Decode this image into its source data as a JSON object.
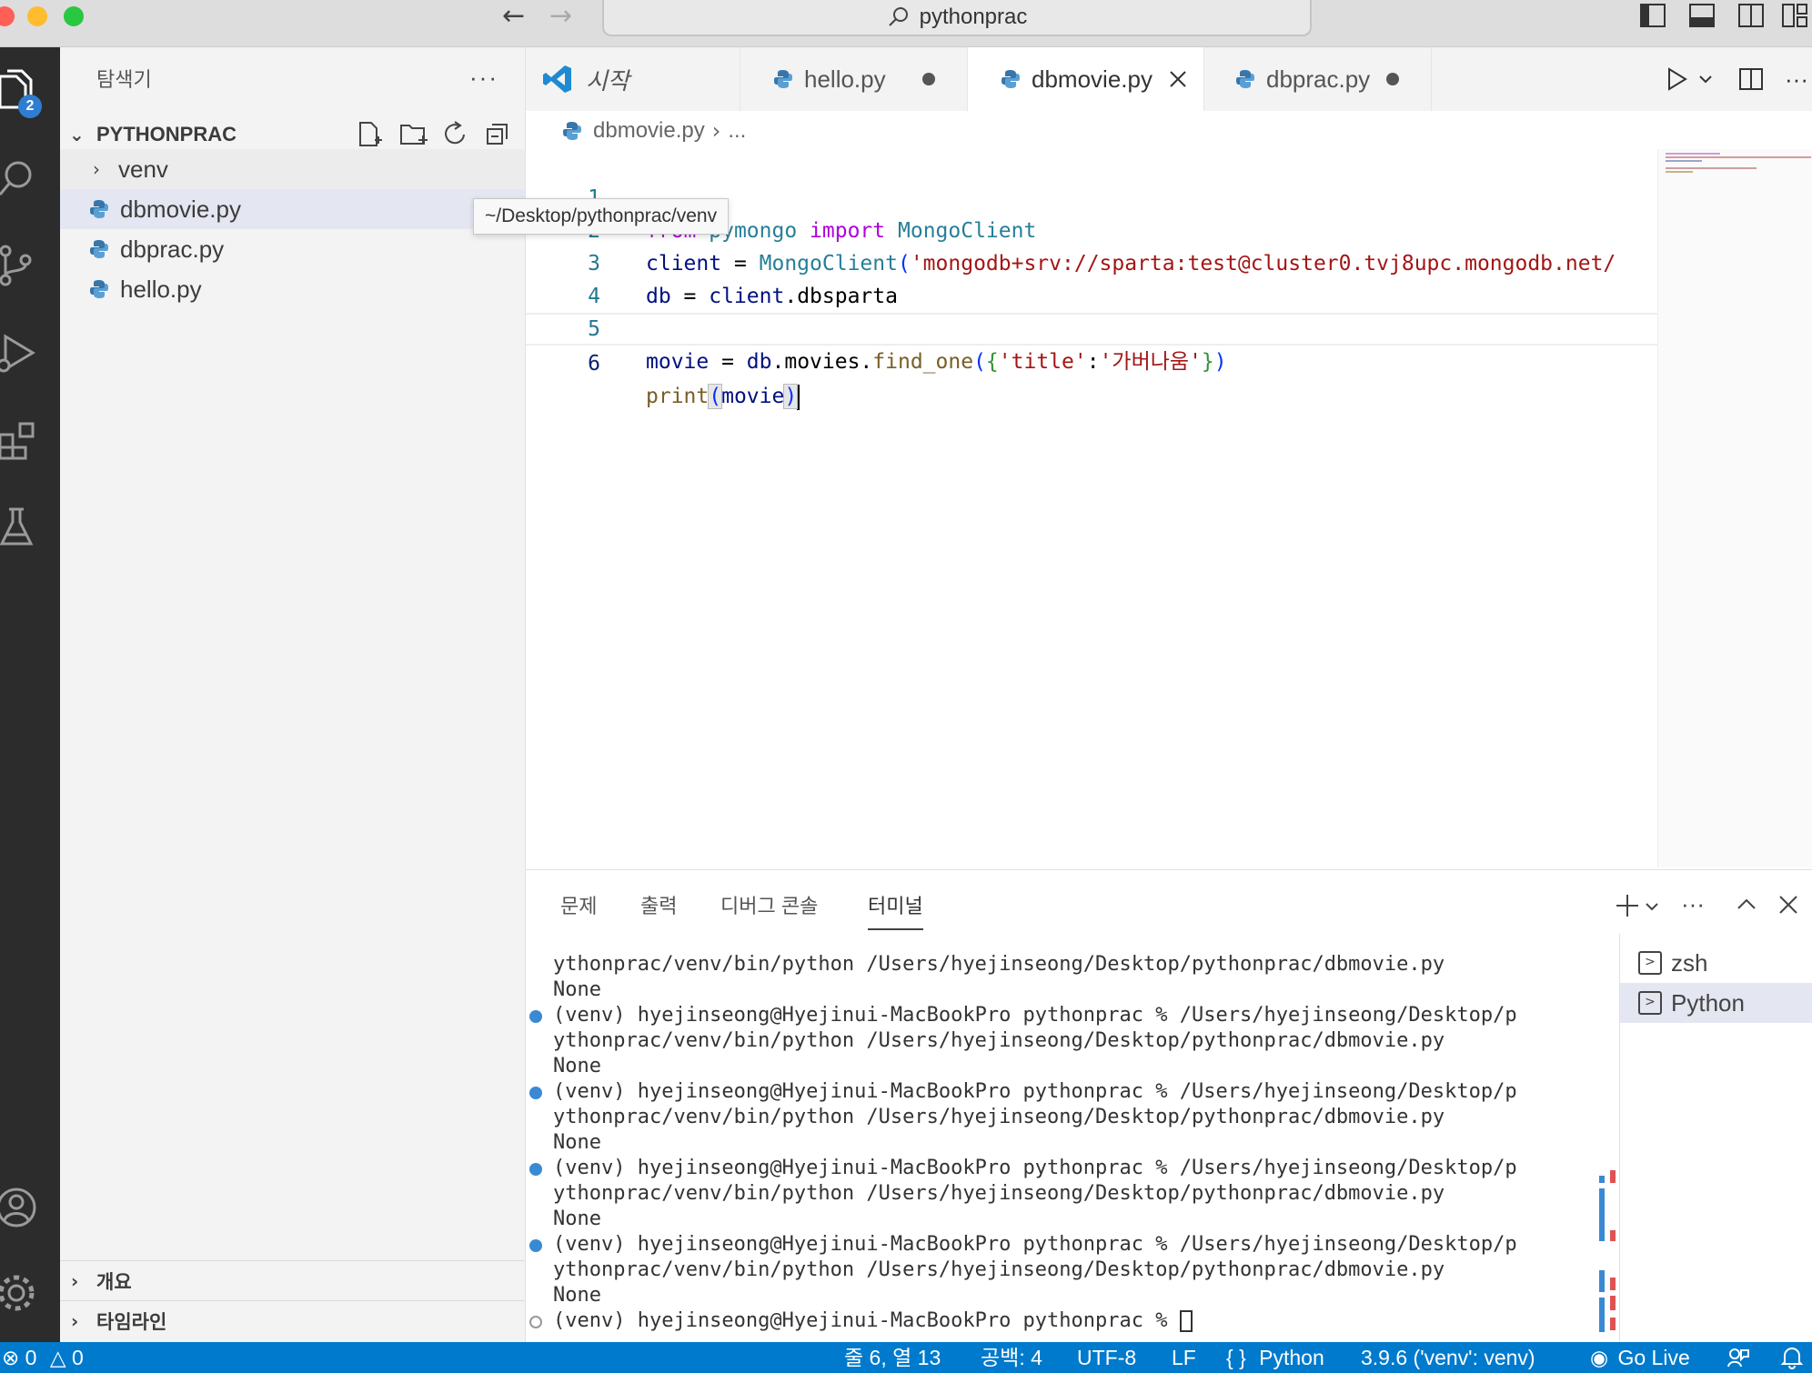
{
  "window": {
    "search_text": "pythonprac",
    "colors": {
      "close": "#ff5f57",
      "minimize": "#febc2e",
      "maximize": "#28c840",
      "accent": "#007acc"
    }
  },
  "activity_bar": {
    "explorer_badge": "2",
    "icons": [
      "files-icon",
      "search-icon",
      "source-control-icon",
      "run-debug-icon",
      "extensions-icon",
      "testing-icon",
      "account-icon",
      "gear-icon"
    ]
  },
  "sidebar": {
    "title": "탐색기",
    "more": "···",
    "project": "PYTHONPRAC",
    "items": [
      {
        "label": "venv",
        "type": "folder"
      },
      {
        "label": "dbmovie.py",
        "type": "python"
      },
      {
        "label": "dbprac.py",
        "type": "python"
      },
      {
        "label": "hello.py",
        "type": "python"
      }
    ],
    "tooltip": "~/Desktop/pythonprac/venv",
    "outline": "개요",
    "timeline": "타임라인"
  },
  "tabs": [
    {
      "label": "시작"
    },
    {
      "label": "hello.py"
    },
    {
      "label": "dbmovie.py"
    },
    {
      "label": "dbprac.py"
    }
  ],
  "breadcrumb": {
    "file": "dbmovie.py",
    "rest": "..."
  },
  "code": {
    "line_numbers": [
      "1",
      "2",
      "3",
      "4",
      "5",
      "6"
    ],
    "l1": {
      "from": "from",
      "module": "pymongo",
      "import": "import",
      "cls": "MongoClient"
    },
    "l2": {
      "var": "client",
      "eq": " = ",
      "cls": "MongoClient",
      "paren": "(",
      "str": "'mongodb+srv://sparta:test@cluster0.tvj8upc.mongodb.net/"
    },
    "l3": {
      "var": "db",
      "eq": " = ",
      "obj": "client",
      "attr": ".dbsparta"
    },
    "l5": {
      "var": "movie",
      "eq": " = ",
      "obj": "db",
      "attr": ".movies.",
      "fn": "find_one",
      "open": "(",
      "brace_open": "{",
      "key": "'title'",
      "colon": ":",
      "val": "'가버나움'",
      "brace_close": "}",
      "close": ")"
    },
    "l6": {
      "fn": "print",
      "open": "(",
      "arg": "movie",
      "close": ")"
    }
  },
  "panel": {
    "tabs": [
      "문제",
      "출력",
      "디버그 콘솔",
      "터미널"
    ],
    "terminal_lines": [
      {
        "text": "ythonprac/venv/bin/python /Users/hyejinseong/Desktop/pythonprac/dbmovie.py",
        "marker": "none"
      },
      {
        "text": "None",
        "marker": "none"
      },
      {
        "text": "(venv) hyejinseong@Hyejinui-MacBookPro pythonprac % /Users/hyejinseong/Desktop/p",
        "marker": "dot"
      },
      {
        "text": "ythonprac/venv/bin/python /Users/hyejinseong/Desktop/pythonprac/dbmovie.py",
        "marker": "none"
      },
      {
        "text": "None",
        "marker": "none"
      },
      {
        "text": "(venv) hyejinseong@Hyejinui-MacBookPro pythonprac % /Users/hyejinseong/Desktop/p",
        "marker": "dot"
      },
      {
        "text": "ythonprac/venv/bin/python /Users/hyejinseong/Desktop/pythonprac/dbmovie.py",
        "marker": "none"
      },
      {
        "text": "None",
        "marker": "none"
      },
      {
        "text": "(venv) hyejinseong@Hyejinui-MacBookPro pythonprac % /Users/hyejinseong/Desktop/p",
        "marker": "dot"
      },
      {
        "text": "ythonprac/venv/bin/python /Users/hyejinseong/Desktop/pythonprac/dbmovie.py",
        "marker": "none"
      },
      {
        "text": "None",
        "marker": "none"
      },
      {
        "text": "(venv) hyejinseong@Hyejinui-MacBookPro pythonprac % /Users/hyejinseong/Desktop/p",
        "marker": "dot"
      },
      {
        "text": "ythonprac/venv/bin/python /Users/hyejinseong/Desktop/pythonprac/dbmovie.py",
        "marker": "none"
      },
      {
        "text": "None",
        "marker": "none"
      },
      {
        "text": "(venv) hyejinseong@Hyejinui-MacBookPro pythonprac % ",
        "marker": "empty"
      }
    ],
    "terminals": [
      "zsh",
      "Python"
    ]
  },
  "statusbar": {
    "errors": "0",
    "warnings": "0",
    "position": "줄 6, 열 13",
    "spaces": "공백: 4",
    "encoding": "UTF-8",
    "eol": "LF",
    "language_icon": "{ }",
    "language": "Python",
    "interpreter": "3.9.6 ('venv': venv)",
    "golive": "Go Live"
  }
}
